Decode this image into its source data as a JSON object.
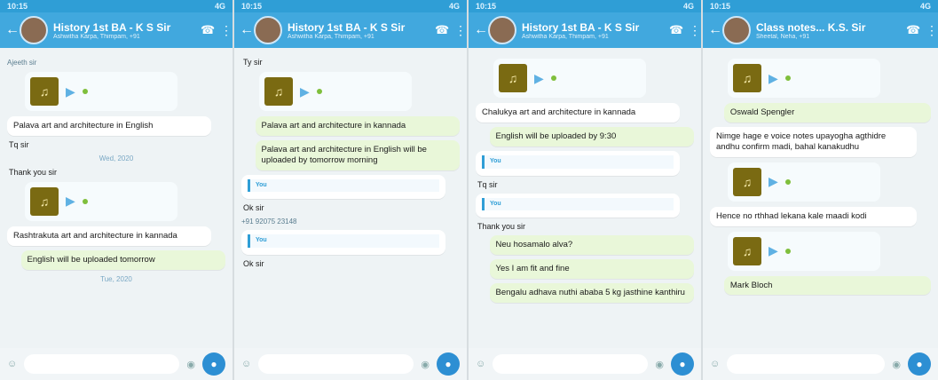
{
  "status": {
    "time": "10:15",
    "icons": "4G"
  },
  "screens": [
    {
      "title": "History 1st BA - K S Sir",
      "subtitle": "Ashwitha Karpa, Thimpam, +91",
      "messages": [
        {
          "kind": "sender",
          "text": "Ajeeth sir"
        },
        {
          "kind": "voice"
        },
        {
          "kind": "in",
          "text": "Palava art and architecture in English"
        },
        {
          "kind": "plain",
          "text": "Tq sir"
        },
        {
          "kind": "date",
          "text": "Wed, 2020"
        },
        {
          "kind": "plain",
          "text": "Thank you sir"
        },
        {
          "kind": "voice"
        },
        {
          "kind": "in",
          "text": "Rashtrakuta art and architecture in kannada"
        },
        {
          "kind": "out",
          "text": "English will be uploaded tomorrow"
        },
        {
          "kind": "date",
          "text": "Tue, 2020"
        }
      ]
    },
    {
      "title": "History 1st BA - K S Sir",
      "subtitle": "Ashwitha Karpa, Thimpam, +91",
      "messages": [
        {
          "kind": "plain",
          "text": "Ty sir"
        },
        {
          "kind": "voice"
        },
        {
          "kind": "out",
          "text": "Palava art and architecture in kannada"
        },
        {
          "kind": "out",
          "text": "Palava art and architecture in English will be uploaded by tomorrow morning"
        },
        {
          "kind": "quote",
          "name": "You",
          "text": ""
        },
        {
          "kind": "plain",
          "text": "Ok sir"
        },
        {
          "kind": "sender",
          "text": "+91 92075 23148"
        },
        {
          "kind": "quote",
          "name": "You",
          "text": ""
        },
        {
          "kind": "plain",
          "text": "Ok sir"
        }
      ]
    },
    {
      "title": "History 1st BA - K S Sir",
      "subtitle": "Ashwitha Karpa, Thimpam, +91",
      "messages": [
        {
          "kind": "voice"
        },
        {
          "kind": "in",
          "text": "Chalukya art and architecture in kannada"
        },
        {
          "kind": "out",
          "text": "English will be uploaded by 9:30"
        },
        {
          "kind": "quote",
          "name": "You",
          "text": ""
        },
        {
          "kind": "plain",
          "text": "Tq sir"
        },
        {
          "kind": "quote",
          "name": "You",
          "text": ""
        },
        {
          "kind": "plain",
          "text": "Thank you sir"
        },
        {
          "kind": "out",
          "text": "Neu hosamalo alva?"
        },
        {
          "kind": "out",
          "text": "Yes I am fit and fine"
        },
        {
          "kind": "out",
          "text": "Bengalu adhava nuthi ababa 5 kg jasthine kanthiru"
        }
      ]
    },
    {
      "title": "Class notes... K.S. Sir",
      "subtitle": "Sheetal, Neha, +91",
      "messages": [
        {
          "kind": "voice"
        },
        {
          "kind": "out",
          "text": "Oswald Spengler"
        },
        {
          "kind": "in",
          "text": "Nimge hage e voice notes upayogha agthidre andhu confirm madi, bahal kanakudhu"
        },
        {
          "kind": "voice"
        },
        {
          "kind": "in",
          "text": "Hence no rthhad lekana kale maadi kodi"
        },
        {
          "kind": "voice"
        },
        {
          "kind": "out",
          "text": "Mark Bloch"
        }
      ]
    }
  ]
}
